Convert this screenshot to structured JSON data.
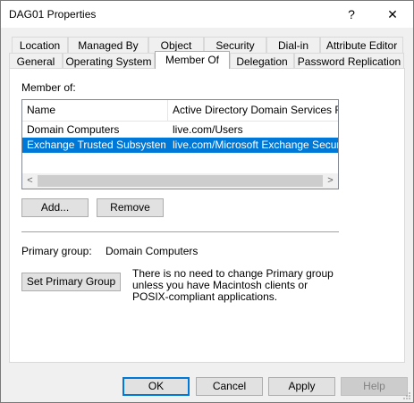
{
  "window": {
    "title": "DAG01 Properties",
    "help_glyph": "?",
    "close_glyph": "✕"
  },
  "tabs": {
    "back_row": [
      "Location",
      "Managed By",
      "Object",
      "Security",
      "Dial-in",
      "Attribute Editor"
    ],
    "front_row": [
      "General",
      "Operating System",
      "Member Of",
      "Delegation",
      "Password Replication"
    ],
    "active": "Member Of"
  },
  "member_of": {
    "label": "Member of:",
    "columns": [
      "Name",
      "Active Directory Domain Services Folder"
    ],
    "rows": [
      {
        "name": "Domain Computers",
        "folder": "live.com/Users",
        "selected": false
      },
      {
        "name": "Exchange Trusted Subsystem",
        "folder": "live.com/Microsoft Exchange Security Groups",
        "selected": true
      }
    ],
    "scroll_left": "<",
    "scroll_right": ">"
  },
  "buttons": {
    "add": "Add...",
    "remove": "Remove",
    "set_primary": "Set Primary Group"
  },
  "primary_group": {
    "label": "Primary group:",
    "value": "Domain Computers",
    "info": "There is no need to change Primary group unless you have Macintosh clients or POSIX-compliant applications."
  },
  "footer": {
    "ok": "OK",
    "cancel": "Cancel",
    "apply": "Apply",
    "help": "Help"
  },
  "colors": {
    "selection": "#0078d7",
    "dialog_bg": "#f0f0f0",
    "panel_bg": "#ffffff"
  }
}
